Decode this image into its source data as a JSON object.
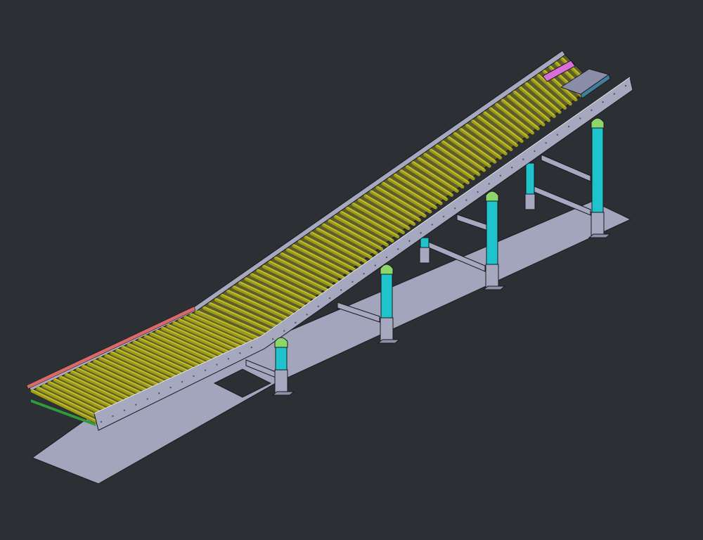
{
  "scene": {
    "roller_count": 92,
    "leg_count": 4,
    "colors": {
      "background": "#2c2f33",
      "floor": "#a2a5bc",
      "frame": "#a6a8bf",
      "frame_dark": "#8e90a8",
      "roller": "#9d9a18",
      "roller_highlight": "#c9c532",
      "leg": "#1fc3cc",
      "bracket": "#8fd66a",
      "guard_red": "#d96a6a",
      "stop_pink": "#d86fd8",
      "edge_green": "#2f9b3a",
      "outline": "#1a1a1f"
    }
  }
}
